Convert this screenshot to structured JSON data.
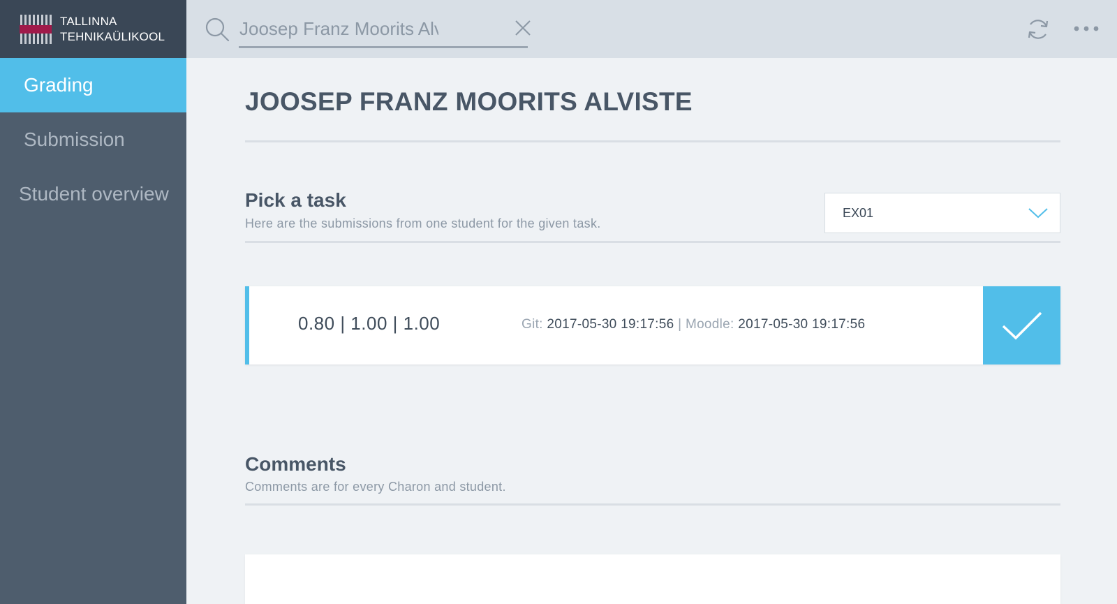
{
  "brand": {
    "line1": "TALLINNA",
    "line2": "TEHNIKAÜLIKOOL"
  },
  "colors": {
    "accent": "#51bee9",
    "sidebar": "#4e5d6d",
    "topbar": "#d8dfe6",
    "logo_band": "#a01a4a"
  },
  "sidebar": {
    "items": [
      {
        "label": "Grading",
        "active": true
      },
      {
        "label": "Submission",
        "active": false
      },
      {
        "label": "Student overview",
        "active": false
      }
    ]
  },
  "search": {
    "value": "Joosep Franz Moorits Alviste",
    "placeholder": ""
  },
  "icons": {
    "search": "search-icon",
    "clear": "close-icon",
    "refresh": "refresh-icon",
    "more": "more-icon",
    "dropdown": "chevron-down-icon",
    "confirm": "check-icon"
  },
  "page": {
    "title": "JOOSEP FRANZ MOORITS ALVISTE"
  },
  "task_section": {
    "title": "Pick a task",
    "subtitle": "Here are the submissions from one student for the given task.",
    "selected_task": "EX01"
  },
  "submission": {
    "grades": "0.80 | 1.00 | 1.00",
    "git_label": "Git:",
    "git_time": "2017-05-30 19:17:56",
    "separator": "|",
    "moodle_label": "Moodle:",
    "moodle_time": "2017-05-30 19:17:56"
  },
  "comments_section": {
    "title": "Comments",
    "subtitle": "Comments are for every Charon and student."
  }
}
